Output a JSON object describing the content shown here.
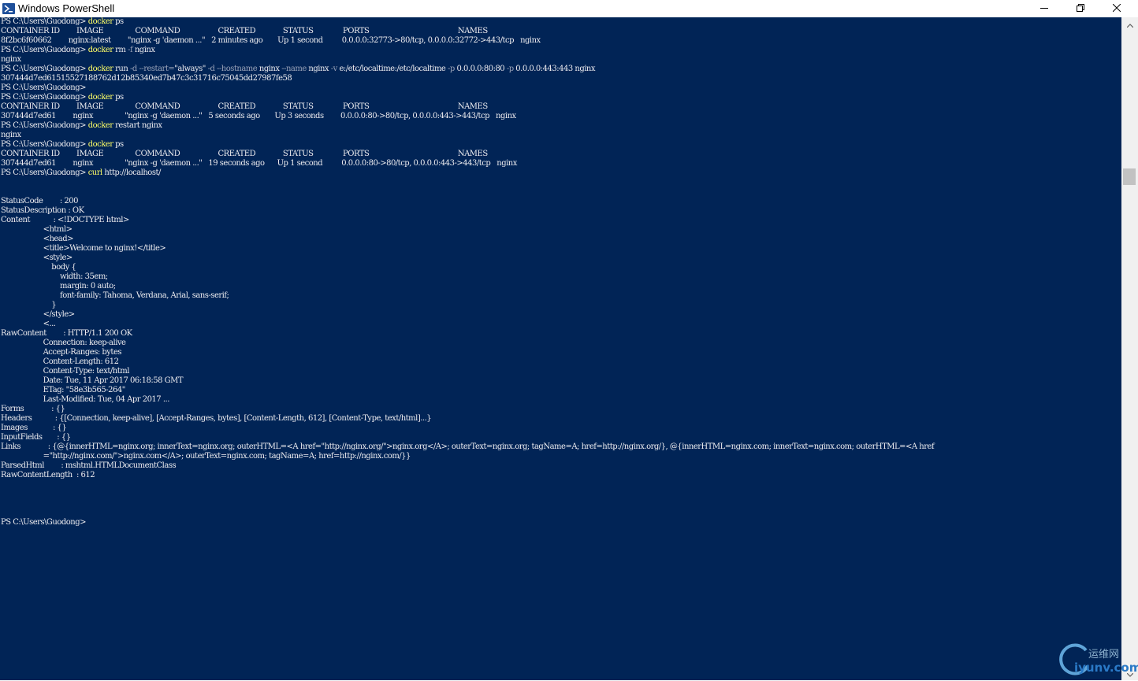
{
  "window": {
    "title": "Windows PowerShell",
    "icon": "powershell-icon",
    "controls": {
      "minimize": "minimize-icon",
      "maximize": "restore-icon",
      "close": "close-icon"
    }
  },
  "colors": {
    "console_bg": "#012456",
    "console_text": "#eeedf0",
    "command_text": "#ffff66",
    "parameter_text": "#9aa3b8",
    "titlebar_bg": "#ffffff",
    "scrollbar_bg": "#f0f0f0"
  },
  "console": {
    "lines": [
      [
        [
          "prompt",
          "PS C:\\Users\\Guodong> "
        ],
        [
          "cmd",
          "docker"
        ],
        [
          "arg",
          " ps"
        ]
      ],
      [
        [
          "text",
          "CONTAINER ID        IMAGE               COMMAND                  CREATED             STATUS              PORTS                                          NAMES"
        ]
      ],
      [
        [
          "text",
          "8f2bc6f60662        nginx:latest        \"nginx -g 'daemon ...\"   2 minutes ago       Up 1 second         0.0.0.0:32773->80/tcp, 0.0.0.0:32772->443/tcp   nginx"
        ]
      ],
      [
        [
          "prompt",
          "PS C:\\Users\\Guodong> "
        ],
        [
          "cmd",
          "docker"
        ],
        [
          "arg",
          " rm "
        ],
        [
          "param",
          "-f"
        ],
        [
          "arg",
          " nginx"
        ]
      ],
      [
        [
          "text",
          "nginx"
        ]
      ],
      [
        [
          "prompt",
          "PS C:\\Users\\Guodong> "
        ],
        [
          "cmd",
          "docker"
        ],
        [
          "arg",
          " run "
        ],
        [
          "param",
          "-d"
        ],
        [
          "arg",
          " "
        ],
        [
          "param",
          "--restart="
        ],
        [
          "arg",
          "\"always\" "
        ],
        [
          "param",
          "-d"
        ],
        [
          "arg",
          " "
        ],
        [
          "param",
          "--hostname"
        ],
        [
          "arg",
          " nginx "
        ],
        [
          "param",
          "--name"
        ],
        [
          "arg",
          " nginx "
        ],
        [
          "param",
          "-v"
        ],
        [
          "arg",
          " e:/etc/localtime:/etc/localtime "
        ],
        [
          "param",
          "-p"
        ],
        [
          "arg",
          " 0.0.0.0:80:80 "
        ],
        [
          "param",
          "-p"
        ],
        [
          "arg",
          " 0.0.0.0:443:443 nginx"
        ]
      ],
      [
        [
          "text",
          "307444d7ed61515527188762d12b85340ed7b47c3c31716c75045dd27987fe58"
        ]
      ],
      [
        [
          "prompt",
          "PS C:\\Users\\Guodong>"
        ]
      ],
      [
        [
          "prompt",
          "PS C:\\Users\\Guodong> "
        ],
        [
          "cmd",
          "docker"
        ],
        [
          "arg",
          " ps"
        ]
      ],
      [
        [
          "text",
          "CONTAINER ID        IMAGE               COMMAND                  CREATED             STATUS              PORTS                                          NAMES"
        ]
      ],
      [
        [
          "text",
          "307444d7ed61        nginx               \"nginx -g 'daemon ...\"   5 seconds ago       Up 3 seconds        0.0.0.0:80->80/tcp, 0.0.0.0:443->443/tcp   nginx"
        ]
      ],
      [
        [
          "prompt",
          "PS C:\\Users\\Guodong> "
        ],
        [
          "cmd",
          "docker"
        ],
        [
          "arg",
          " restart nginx"
        ]
      ],
      [
        [
          "text",
          "nginx"
        ]
      ],
      [
        [
          "prompt",
          "PS C:\\Users\\Guodong> "
        ],
        [
          "cmd",
          "docker"
        ],
        [
          "arg",
          " ps"
        ]
      ],
      [
        [
          "text",
          "CONTAINER ID        IMAGE               COMMAND                  CREATED             STATUS              PORTS                                          NAMES"
        ]
      ],
      [
        [
          "text",
          "307444d7ed61        nginx               \"nginx -g 'daemon ...\"   19 seconds ago      Up 1 second         0.0.0.0:80->80/tcp, 0.0.0.0:443->443/tcp   nginx"
        ]
      ],
      [
        [
          "prompt",
          "PS C:\\Users\\Guodong> "
        ],
        [
          "cmd",
          "curl"
        ],
        [
          "arg",
          " http://localhost/"
        ]
      ],
      [
        [
          "text",
          ""
        ]
      ],
      [
        [
          "text",
          ""
        ]
      ],
      [
        [
          "text",
          "StatusCode        : 200"
        ]
      ],
      [
        [
          "text",
          "StatusDescription : OK"
        ]
      ],
      [
        [
          "text",
          "Content           : <!DOCTYPE html>"
        ]
      ],
      [
        [
          "text",
          "                    <html>"
        ]
      ],
      [
        [
          "text",
          "                    <head>"
        ]
      ],
      [
        [
          "text",
          "                    <title>Welcome to nginx!</title>"
        ]
      ],
      [
        [
          "text",
          "                    <style>"
        ]
      ],
      [
        [
          "text",
          "                        body {"
        ]
      ],
      [
        [
          "text",
          "                            width: 35em;"
        ]
      ],
      [
        [
          "text",
          "                            margin: 0 auto;"
        ]
      ],
      [
        [
          "text",
          "                            font-family: Tahoma, Verdana, Arial, sans-serif;"
        ]
      ],
      [
        [
          "text",
          "                        }"
        ]
      ],
      [
        [
          "text",
          "                    </style>"
        ]
      ],
      [
        [
          "text",
          "                    <..."
        ]
      ],
      [
        [
          "text",
          "RawContent        : HTTP/1.1 200 OK"
        ]
      ],
      [
        [
          "text",
          "                    Connection: keep-alive"
        ]
      ],
      [
        [
          "text",
          "                    Accept-Ranges: bytes"
        ]
      ],
      [
        [
          "text",
          "                    Content-Length: 612"
        ]
      ],
      [
        [
          "text",
          "                    Content-Type: text/html"
        ]
      ],
      [
        [
          "text",
          "                    Date: Tue, 11 Apr 2017 06:18:58 GMT"
        ]
      ],
      [
        [
          "text",
          "                    ETag: \"58e3b565-264\""
        ]
      ],
      [
        [
          "text",
          "                    Last-Modified: Tue, 04 Apr 2017 ..."
        ]
      ],
      [
        [
          "text",
          "Forms             : {}"
        ]
      ],
      [
        [
          "text",
          "Headers           : {[Connection, keep-alive], [Accept-Ranges, bytes], [Content-Length, 612], [Content-Type, text/html]...}"
        ]
      ],
      [
        [
          "text",
          "Images            : {}"
        ]
      ],
      [
        [
          "text",
          "InputFields       : {}"
        ]
      ],
      [
        [
          "text",
          "Links             : {@{innerHTML=nginx.org; innerText=nginx.org; outerHTML=<A href=\"http://nginx.org/\">nginx.org</A>; outerText=nginx.org; tagName=A; href=http://nginx.org/}, @{innerHTML=nginx.com; innerText=nginx.com; outerHTML=<A href"
        ]
      ],
      [
        [
          "text",
          "                    =\"http://nginx.com/\">nginx.com</A>; outerText=nginx.com; tagName=A; href=http://nginx.com/}}"
        ]
      ],
      [
        [
          "text",
          "ParsedHtml        : mshtml.HTMLDocumentClass"
        ]
      ],
      [
        [
          "text",
          "RawContentLength  : 612"
        ]
      ],
      [
        [
          "text",
          ""
        ]
      ],
      [
        [
          "text",
          ""
        ]
      ],
      [
        [
          "text",
          ""
        ]
      ],
      [
        [
          "text",
          ""
        ]
      ],
      [
        [
          "prompt",
          "PS C:\\Users\\Guodong>"
        ]
      ]
    ]
  },
  "watermark": {
    "text_cn": "运维网",
    "text_en": "iyunv.com"
  }
}
